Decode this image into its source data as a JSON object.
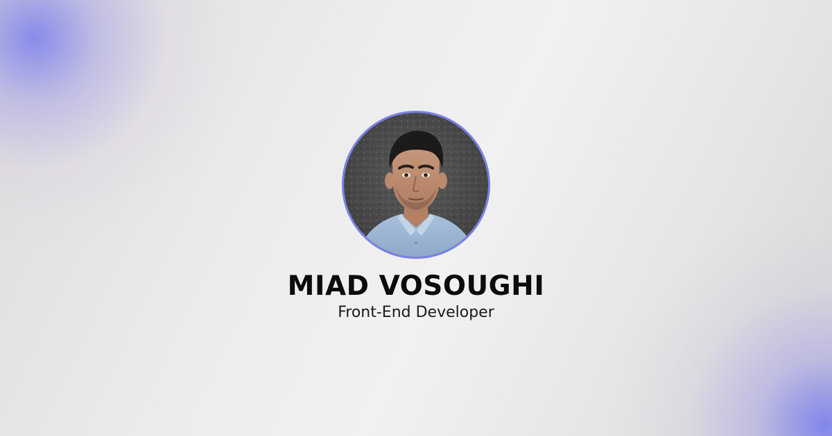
{
  "profile": {
    "name": "MIAD VOSOUGHI",
    "role": "Front-End Developer",
    "avatar_icon": "profile-photo"
  },
  "colors": {
    "ring": "#7b80e6",
    "name_text": "#0c0c0c",
    "role_text": "#1a1a1a",
    "glow": "#7880eb"
  }
}
